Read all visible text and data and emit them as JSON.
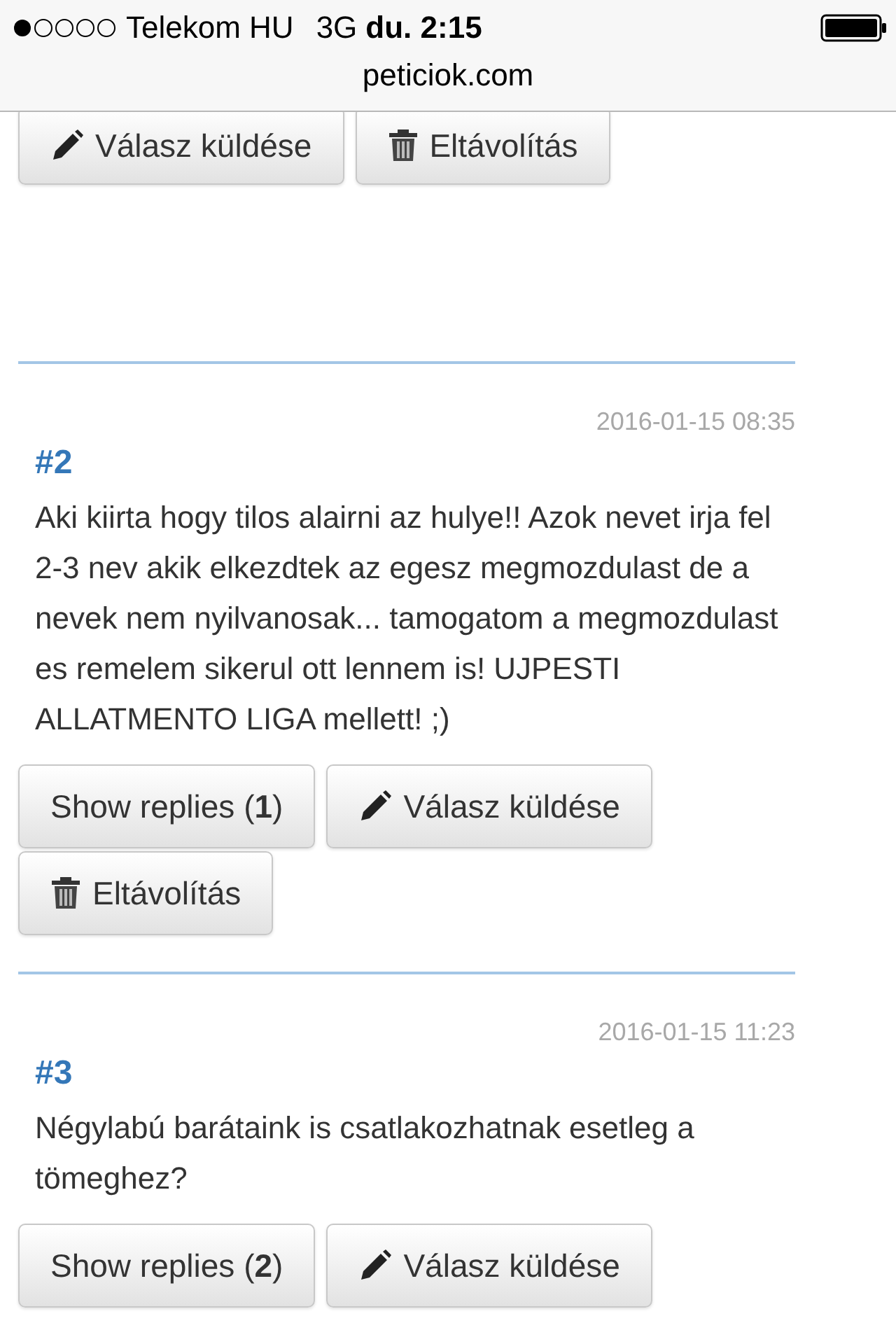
{
  "status_bar": {
    "carrier": "Telekom HU",
    "network": "3G",
    "time": "du. 2:15",
    "url": "peticiok.com"
  },
  "top_actions": [
    {
      "kind": "reply",
      "label": "Válasz küldése"
    },
    {
      "kind": "remove",
      "label": "Eltávolítás"
    }
  ],
  "comments": [
    {
      "number": "#2",
      "date": "2016-01-15 08:35",
      "text": "Aki kiirta hogy tilos alairni az hulye!! Azok nevet irja fel 2-3 nev akik elkezdtek az egesz megmozdulast de a nevek nem nyilvanosak... tamogatom a megmozdulast es remelem sikerul ott lennem is! UJPESTI ALLATMENTO LIGA mellett! ;)",
      "actions": [
        {
          "kind": "replies",
          "label": "Show replies (**1**)"
        },
        {
          "kind": "reply",
          "label": "Válasz küldése"
        },
        {
          "kind": "remove",
          "label": "Eltávolítás"
        }
      ]
    },
    {
      "number": "#3",
      "date": "2016-01-15 11:23",
      "text": "Négylabú barátaink is csatlakozhatnak esetleg a tömeghez?",
      "actions": [
        {
          "kind": "replies",
          "label": "Show replies (**2**)"
        },
        {
          "kind": "reply",
          "label": "Válasz küldése"
        }
      ]
    }
  ]
}
